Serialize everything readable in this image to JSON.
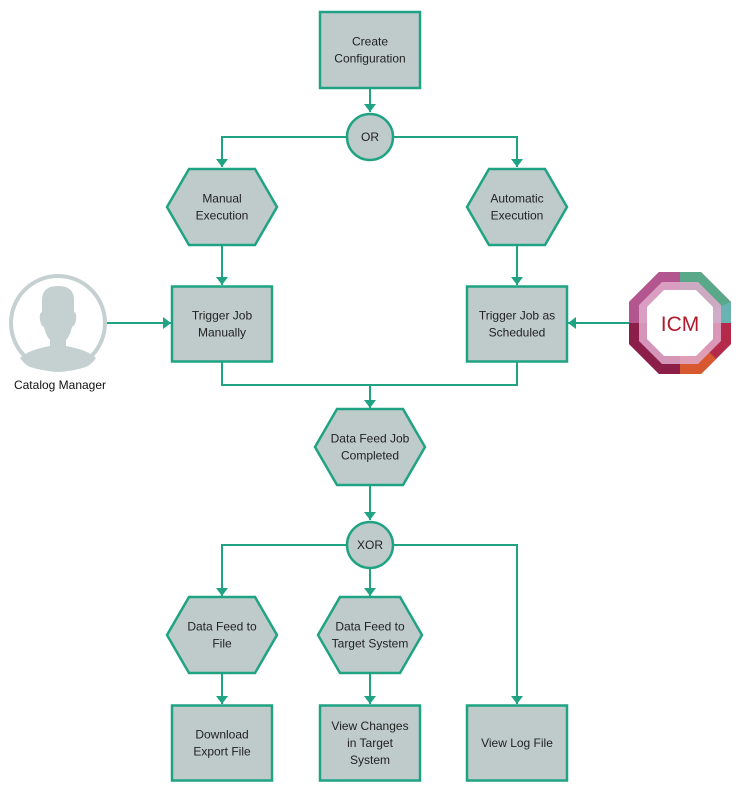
{
  "diagram": {
    "nodes": [
      {
        "id": "create-config",
        "type": "process",
        "lines": [
          "Create",
          "Configuration"
        ]
      },
      {
        "id": "or-gate",
        "type": "gate",
        "lines": [
          "OR"
        ]
      },
      {
        "id": "manual-execution",
        "type": "event",
        "lines": [
          "Manual",
          "Execution"
        ]
      },
      {
        "id": "automatic-execution",
        "type": "event",
        "lines": [
          "Automatic",
          "Execution"
        ]
      },
      {
        "id": "trigger-manually",
        "type": "process",
        "lines": [
          "Trigger Job",
          "Manually"
        ]
      },
      {
        "id": "trigger-scheduled",
        "type": "process",
        "lines": [
          "Trigger Job as",
          "Scheduled"
        ]
      },
      {
        "id": "job-completed",
        "type": "event",
        "lines": [
          "Data Feed Job",
          "Completed"
        ]
      },
      {
        "id": "xor-gate",
        "type": "gate",
        "lines": [
          "XOR"
        ]
      },
      {
        "id": "feed-to-file",
        "type": "event",
        "lines": [
          "Data Feed to",
          "File"
        ]
      },
      {
        "id": "feed-to-target",
        "type": "event",
        "lines": [
          "Data Feed to",
          "Target System"
        ]
      },
      {
        "id": "download-export",
        "type": "process",
        "lines": [
          "Download",
          "Export File"
        ]
      },
      {
        "id": "view-changes",
        "type": "process",
        "lines": [
          "View Changes",
          "in Target",
          "System"
        ]
      },
      {
        "id": "view-log",
        "type": "process",
        "lines": [
          "View Log File"
        ]
      }
    ],
    "actors": {
      "catalog_manager": {
        "label": "Catalog Manager",
        "icon": "user-silhouette-icon"
      },
      "icm": {
        "label": "ICM",
        "icon": "icm-logo-icon",
        "text_color": "#b01c2e"
      }
    },
    "edges": [
      {
        "from": "create-config",
        "to": "or-gate"
      },
      {
        "from": "or-gate",
        "to": "manual-execution"
      },
      {
        "from": "or-gate",
        "to": "automatic-execution"
      },
      {
        "from": "manual-execution",
        "to": "trigger-manually"
      },
      {
        "from": "automatic-execution",
        "to": "trigger-scheduled"
      },
      {
        "from": "catalog_manager",
        "to": "trigger-manually"
      },
      {
        "from": "icm",
        "to": "trigger-scheduled"
      },
      {
        "from": "trigger-manually",
        "to": "job-completed"
      },
      {
        "from": "trigger-scheduled",
        "to": "job-completed"
      },
      {
        "from": "job-completed",
        "to": "xor-gate"
      },
      {
        "from": "xor-gate",
        "to": "feed-to-file"
      },
      {
        "from": "xor-gate",
        "to": "feed-to-target"
      },
      {
        "from": "xor-gate",
        "to": "view-log"
      },
      {
        "from": "feed-to-file",
        "to": "download-export"
      },
      {
        "from": "feed-to-target",
        "to": "view-changes"
      }
    ],
    "colors": {
      "stroke": "#1fa383",
      "fill": "#bfcbcb",
      "avatar": "#c5d0d0"
    }
  }
}
